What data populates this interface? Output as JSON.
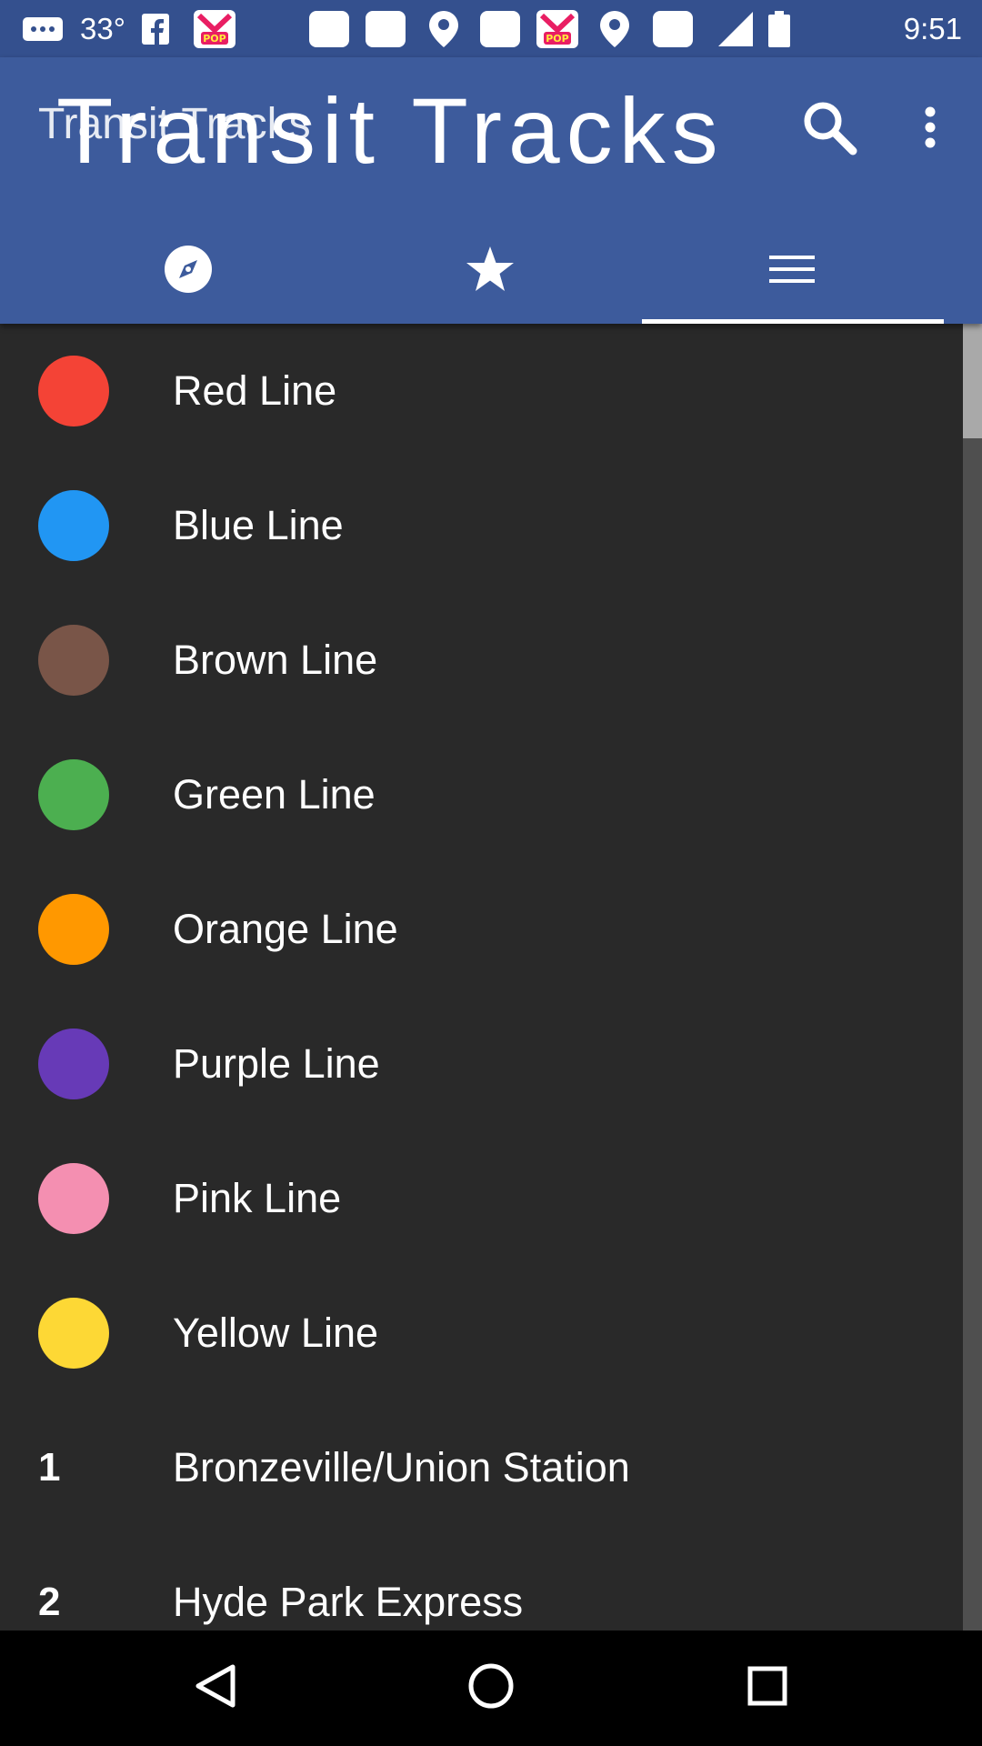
{
  "status_bar": {
    "temperature": "33°",
    "time": "9:51"
  },
  "app_bar": {
    "title": "Transit Tracks",
    "actions": [
      "search-icon",
      "more-options-icon"
    ]
  },
  "tabs": [
    {
      "icon": "compass-icon",
      "selected": false
    },
    {
      "icon": "star-icon",
      "selected": false
    },
    {
      "icon": "menu-list-icon",
      "selected": true
    }
  ],
  "lines": [
    {
      "label": "Red Line",
      "color": "#f44336"
    },
    {
      "label": "Blue Line",
      "color": "#2196f3"
    },
    {
      "label": "Brown Line",
      "color": "#795548"
    },
    {
      "label": "Green Line",
      "color": "#4caf50"
    },
    {
      "label": "Orange Line",
      "color": "#ff9800"
    },
    {
      "label": "Purple Line",
      "color": "#673ab7"
    },
    {
      "label": "Pink Line",
      "color": "#f48fb1"
    },
    {
      "label": "Yellow Line",
      "color": "#fdd835"
    }
  ],
  "routes": [
    {
      "number": "1",
      "label": "Bronzeville/Union Station"
    },
    {
      "number": "2",
      "label": "Hyde Park Express"
    }
  ],
  "colors": {
    "status_bar": "#34508e",
    "app_bar": "#3d5b9c",
    "list_background": "#292929"
  }
}
